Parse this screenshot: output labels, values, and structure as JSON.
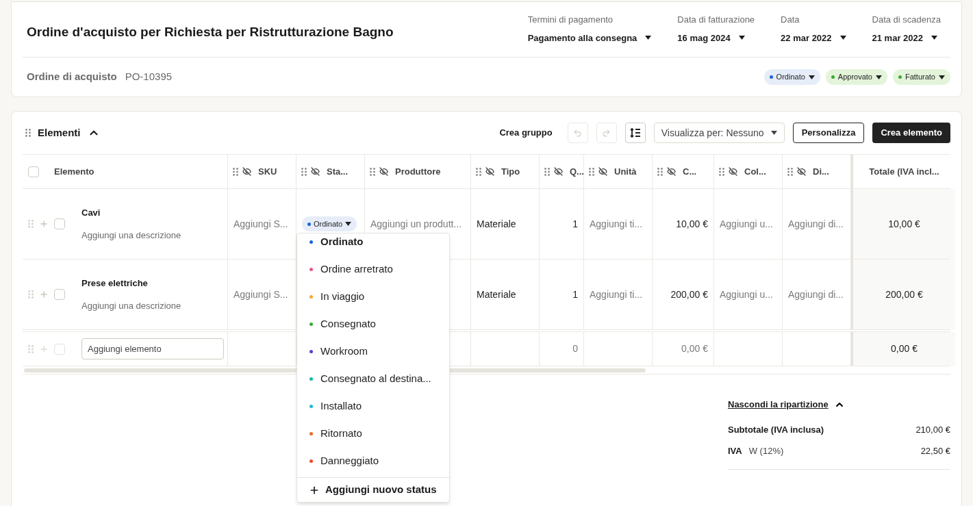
{
  "header": {
    "title": "Ordine d'acquisto per Richiesta per Ristrutturazione Bagno",
    "fields": [
      {
        "label": "Termini di pagamento",
        "value": "Pagamento alla consegna"
      },
      {
        "label": "Data di fatturazione",
        "value": "16 mag 2024"
      },
      {
        "label": "Data",
        "value": "22 mar 2022"
      },
      {
        "label": "Data di scadenza",
        "value": "21 mar 2022"
      }
    ],
    "po_label": "Ordine di acquisto",
    "po_number": "PO-10395",
    "status_badges": [
      {
        "label": "Ordinato",
        "color": "#1e63d6"
      },
      {
        "label": "Approvato",
        "color": "#3aaa35"
      },
      {
        "label": "Fatturato",
        "color": "#3aaa35"
      }
    ]
  },
  "items": {
    "title": "Elementi",
    "expanded": true,
    "toolbar": {
      "create_group": "Crea gruppo",
      "undo_disabled": true,
      "redo_disabled": true,
      "view_by": "Visualizza per: Nessuno",
      "customize": "Personalizza",
      "create": "Crea elemento"
    },
    "columns": [
      {
        "label": "Elemento",
        "kind": "select",
        "checked": false
      },
      {
        "label": "SKU",
        "kind": "text"
      },
      {
        "label": "Sta...",
        "kind": "text"
      },
      {
        "label": "Produttore",
        "kind": "text"
      },
      {
        "label": "Tipo",
        "kind": "text"
      },
      {
        "label": "Q...",
        "kind": "number"
      },
      {
        "label": "Unità",
        "kind": "text"
      },
      {
        "label": "C...",
        "kind": "number"
      },
      {
        "label": "Col...",
        "kind": "text"
      },
      {
        "label": "Di...",
        "kind": "text"
      },
      {
        "label": "Totale (IVA incl...",
        "kind": "total"
      }
    ],
    "rows": [
      {
        "cells": [
          {
            "kind": "item",
            "name": "Cavi",
            "description": "Aggiungi una descrizione",
            "checked": false
          },
          {
            "kind": "text",
            "text": "Aggiungi S...",
            "muted": true
          },
          {
            "kind": "status",
            "text": "Ordinato",
            "color": "#1e63d6"
          },
          {
            "kind": "text",
            "text": "Aggiungi un produtt...",
            "muted": true
          },
          {
            "kind": "text",
            "text": "Materiale",
            "muted": false
          },
          {
            "kind": "text",
            "text": "1",
            "muted": false
          },
          {
            "kind": "text",
            "text": "Aggiungi ti...",
            "muted": true
          },
          {
            "kind": "text",
            "text": "10,00 €",
            "muted": false
          },
          {
            "kind": "text",
            "text": "Aggiungi u...",
            "muted": true
          },
          {
            "kind": "text",
            "text": "Aggiungi di...",
            "muted": true
          },
          {
            "kind": "text",
            "text": "10,00 €",
            "muted": false
          }
        ]
      },
      {
        "cells": [
          {
            "kind": "item",
            "name": "Prese elettriche",
            "description": "Aggiungi una descrizione",
            "checked": false
          },
          {
            "kind": "text",
            "text": "Aggiungi S...",
            "muted": true
          },
          {
            "kind": "empty"
          },
          {
            "kind": "empty"
          },
          {
            "kind": "text",
            "text": "Materiale",
            "muted": false
          },
          {
            "kind": "text",
            "text": "1",
            "muted": false
          },
          {
            "kind": "text",
            "text": "Aggiungi ti...",
            "muted": true
          },
          {
            "kind": "text",
            "text": "200,00 €",
            "muted": false
          },
          {
            "kind": "text",
            "text": "Aggiungi u...",
            "muted": true
          },
          {
            "kind": "text",
            "text": "Aggiungi di...",
            "muted": true
          },
          {
            "kind": "text",
            "text": "200,00 €",
            "muted": false
          }
        ]
      }
    ],
    "add_row": {
      "cells": [
        {
          "kind": "input",
          "placeholder": "Aggiungi elemento",
          "checked": false
        },
        {
          "kind": "empty"
        },
        {
          "kind": "empty"
        },
        {
          "kind": "empty"
        },
        {
          "kind": "empty"
        },
        {
          "kind": "text",
          "text": "0",
          "muted": true
        },
        {
          "kind": "empty"
        },
        {
          "kind": "text",
          "text": "0,00 €",
          "muted": true
        },
        {
          "kind": "empty"
        },
        {
          "kind": "empty"
        },
        {
          "kind": "text",
          "text": "0,00 €",
          "muted": false
        }
      ]
    },
    "status_menu": {
      "add_label": "Aggiungi nuovo status",
      "options": [
        {
          "label": "Ordinato",
          "color": "#1e63d6",
          "selected": true
        },
        {
          "label": "Ordine arretrato",
          "color": "#e8578a",
          "selected": false
        },
        {
          "label": "In viaggio",
          "color": "#f2aa2b",
          "selected": false
        },
        {
          "label": "Consegnato",
          "color": "#3aaa35",
          "selected": false
        },
        {
          "label": "Workroom",
          "color": "#5b3fd1",
          "selected": false
        },
        {
          "label": "Consegnato al destina...",
          "color": "#14b8a6",
          "selected": false
        },
        {
          "label": "Installato",
          "color": "#17bcd6",
          "selected": false
        },
        {
          "label": "Ritornato",
          "color": "#f06a2a",
          "selected": false
        },
        {
          "label": "Danneggiato",
          "color": "#ee4b34",
          "selected": false
        }
      ]
    },
    "summary": {
      "toggle": "Nascondi la ripartizione",
      "expanded": true,
      "lines": [
        {
          "label": "Subtotale (IVA inclusa)",
          "value": "210,00 €"
        },
        {
          "label": "IVA",
          "detail": "W (12%)",
          "value": "22,50 €"
        }
      ]
    }
  }
}
